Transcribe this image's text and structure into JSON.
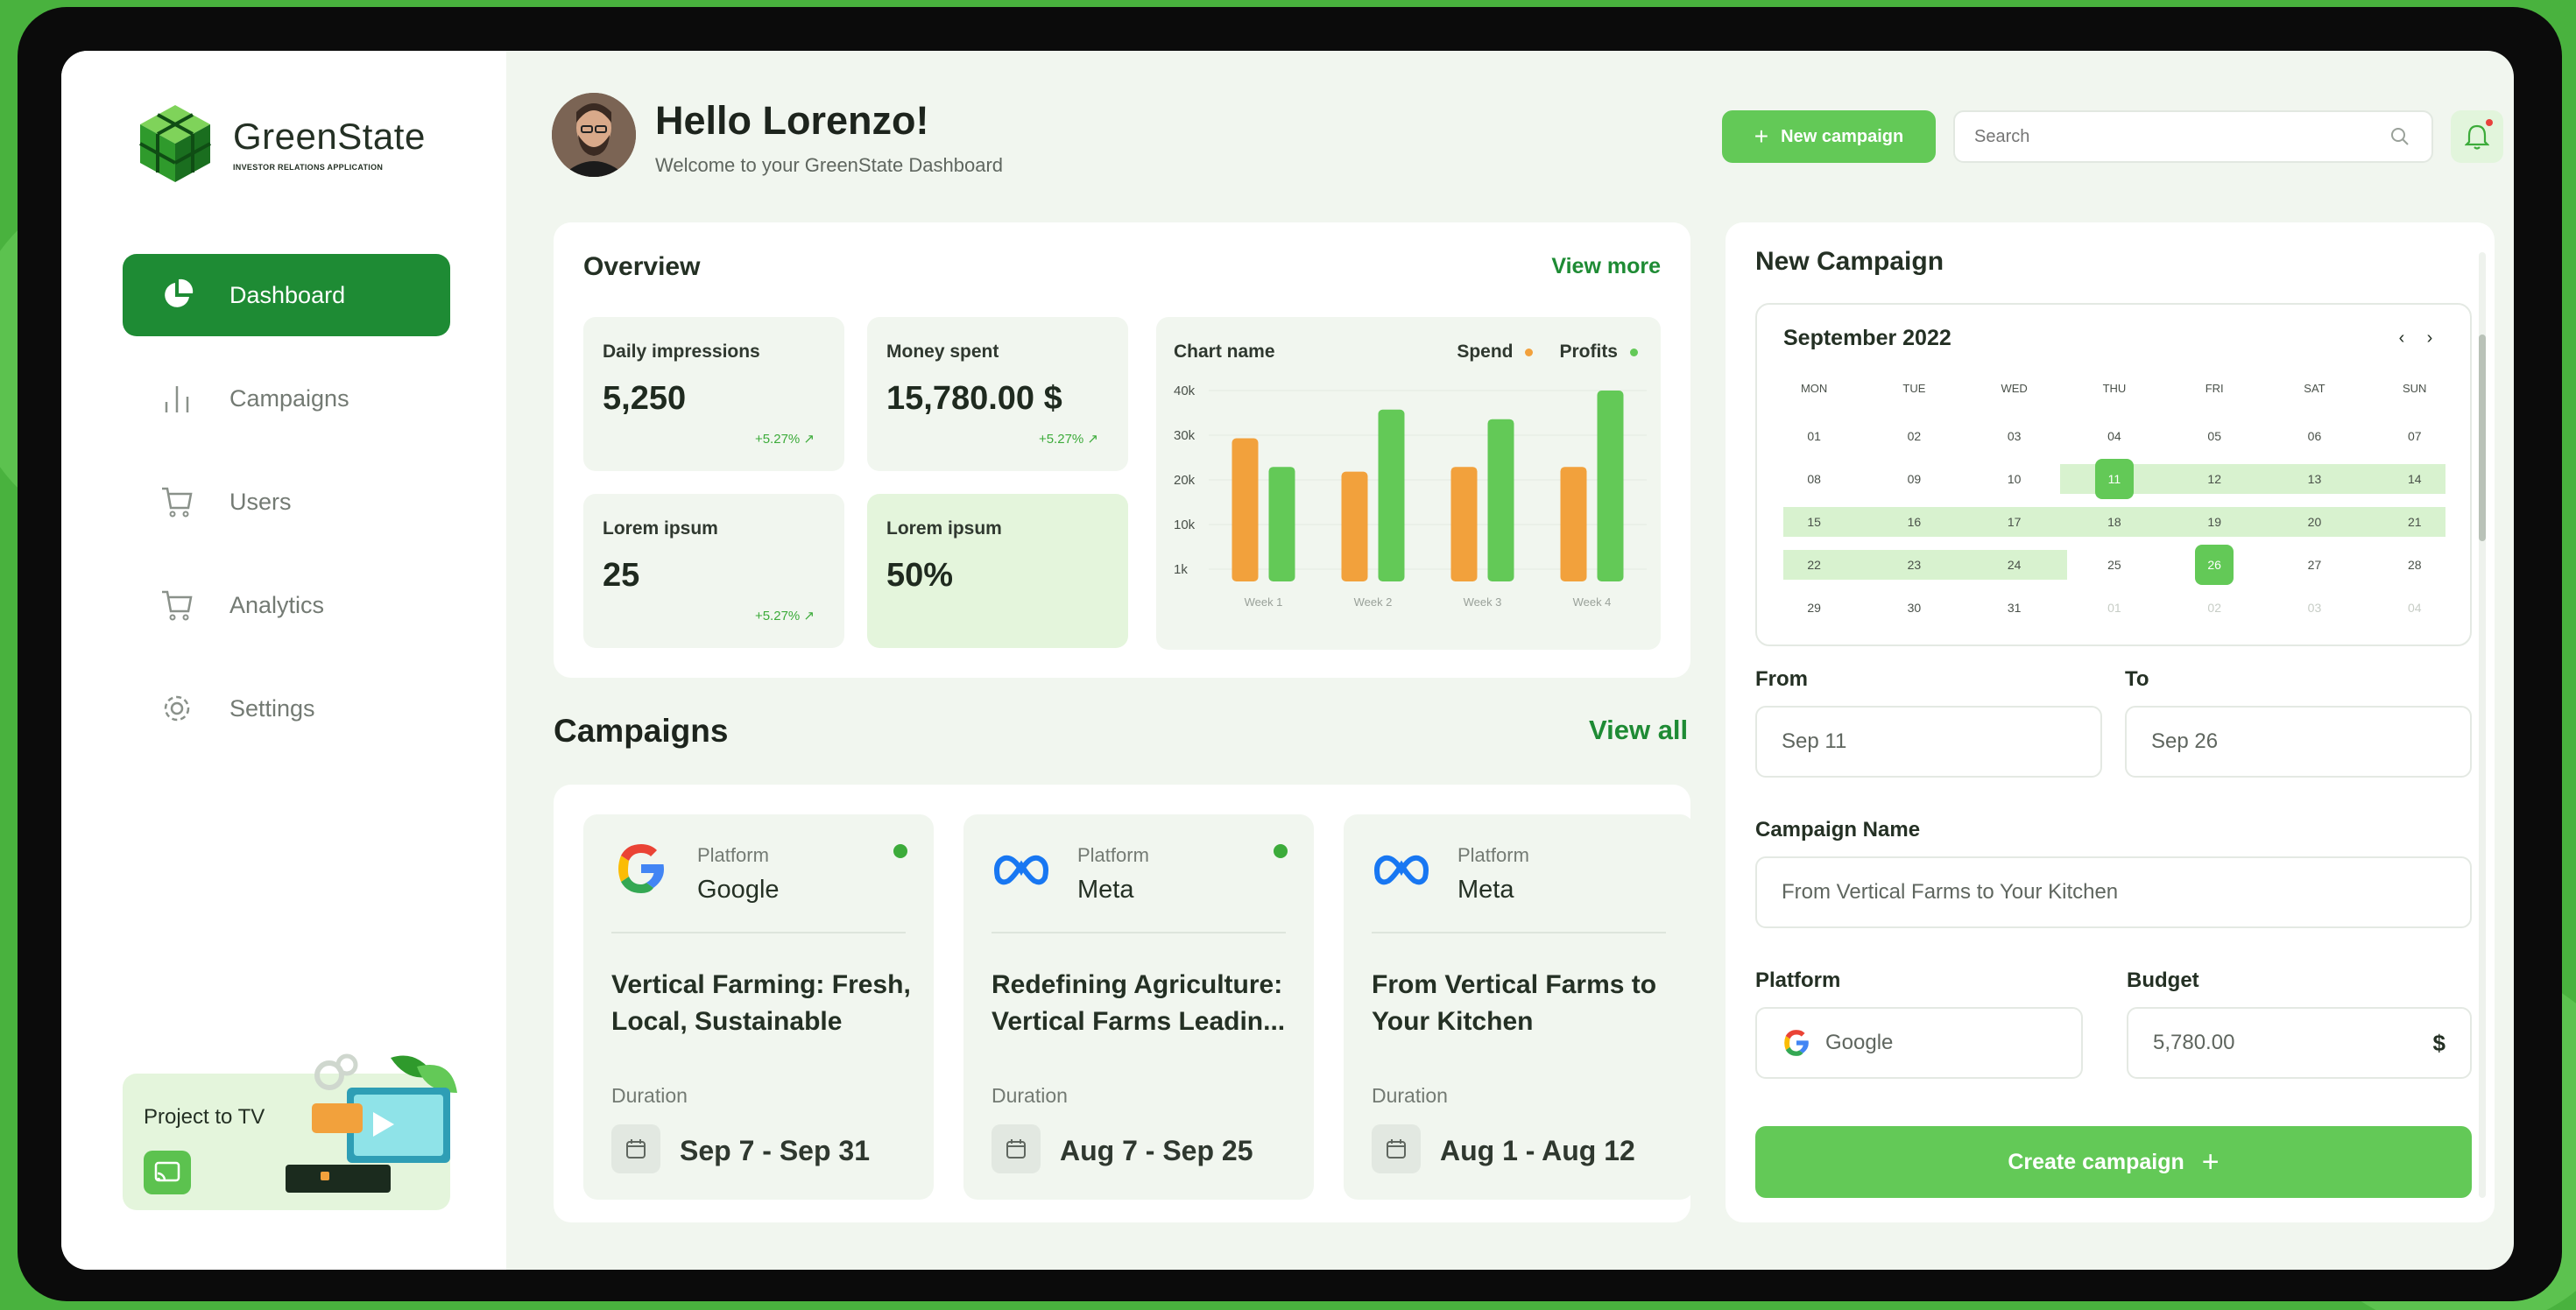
{
  "app": {
    "name": "GreenState",
    "subtitle": "INVESTOR RELATIONS APPLICATION"
  },
  "sidebar": {
    "items": [
      {
        "label": "Dashboard",
        "icon": "pie-chart-icon",
        "active": true
      },
      {
        "label": "Campaigns",
        "icon": "bar-chart-icon",
        "active": false
      },
      {
        "label": "Users",
        "icon": "cart-icon",
        "active": false
      },
      {
        "label": "Analytics",
        "icon": "cart-icon",
        "active": false
      },
      {
        "label": "Settings",
        "icon": "gear-icon",
        "active": false
      }
    ],
    "project_to_tv": "Project to TV"
  },
  "header": {
    "greeting": "Hello Lorenzo!",
    "welcome": "Welcome to your GreenState Dashboard",
    "new_campaign_label": "New campaign",
    "search_placeholder": "Search"
  },
  "overview": {
    "title": "Overview",
    "view_more": "View more",
    "stats": [
      {
        "label": "Daily impressions",
        "value": "5,250",
        "change": "+5.27%"
      },
      {
        "label": "Money spent",
        "value": "15,780.00 $",
        "change": "+5.27%"
      },
      {
        "label": "Lorem ipsum",
        "value": "25",
        "change": "+5.27%"
      },
      {
        "label": "Lorem ipsum",
        "value": "50%",
        "change": ""
      }
    ]
  },
  "chart_data": {
    "type": "bar",
    "title": "Chart name",
    "categories": [
      "Week 1",
      "Week 2",
      "Week 3",
      "Week 4"
    ],
    "series": [
      {
        "name": "Spend",
        "color": "#f2a13c",
        "values": [
          30,
          23,
          24,
          24
        ]
      },
      {
        "name": "Profits",
        "color": "#63c957",
        "values": [
          24,
          36,
          34,
          40
        ]
      }
    ],
    "y_ticks": [
      "40k",
      "30k",
      "20k",
      "10k",
      "1k"
    ],
    "ylim": [
      0,
      40
    ],
    "grid": true,
    "legend": "top-right"
  },
  "campaigns": {
    "title": "Campaigns",
    "view_all": "View all",
    "platform_label": "Platform",
    "duration_label": "Duration",
    "items": [
      {
        "platform": "Google",
        "logo": "google-logo-icon",
        "title": "Vertical Farming: Fresh, Local, Sustainable",
        "duration": "Sep 7 - Sep 31",
        "active": true
      },
      {
        "platform": "Meta",
        "logo": "meta-logo-icon",
        "title": "Redefining Agriculture: Vertical Farms Leadin...",
        "duration": "Aug 7 - Sep 25",
        "active": true
      },
      {
        "platform": "Meta",
        "logo": "meta-logo-icon",
        "title": "From Vertical Farms to Your Kitchen",
        "duration": "Aug 1 - Aug 12",
        "active": false
      }
    ]
  },
  "new_campaign": {
    "title": "New Campaign",
    "calendar": {
      "month": "September 2022",
      "weekdays": [
        "MON",
        "TUE",
        "WED",
        "THU",
        "FRI",
        "SAT",
        "SUN"
      ],
      "weeks": [
        [
          "01",
          "02",
          "03",
          "04",
          "05",
          "06",
          "07"
        ],
        [
          "08",
          "09",
          "10",
          "11",
          "12",
          "13",
          "14"
        ],
        [
          "15",
          "16",
          "17",
          "18",
          "19",
          "20",
          "21"
        ],
        [
          "22",
          "23",
          "24",
          "25",
          "26",
          "27",
          "28"
        ],
        [
          "29",
          "30",
          "31",
          "01",
          "02",
          "03",
          "04"
        ]
      ],
      "selected_start": "11",
      "selected_end": "26"
    },
    "from_label": "From",
    "to_label": "To",
    "from_value": "Sep 11",
    "to_value": "Sep 26",
    "name_label": "Campaign Name",
    "name_value": "From Vertical Farms to Your Kitchen",
    "platform_label": "Platform",
    "platform_value": "Google",
    "budget_label": "Budget",
    "budget_value": "5,780.00",
    "currency": "$",
    "create_label": "Create campaign"
  },
  "colors": {
    "primary": "#1e8b34",
    "accent": "#63c957",
    "spend": "#f2a13c",
    "background": "#49b23e"
  }
}
